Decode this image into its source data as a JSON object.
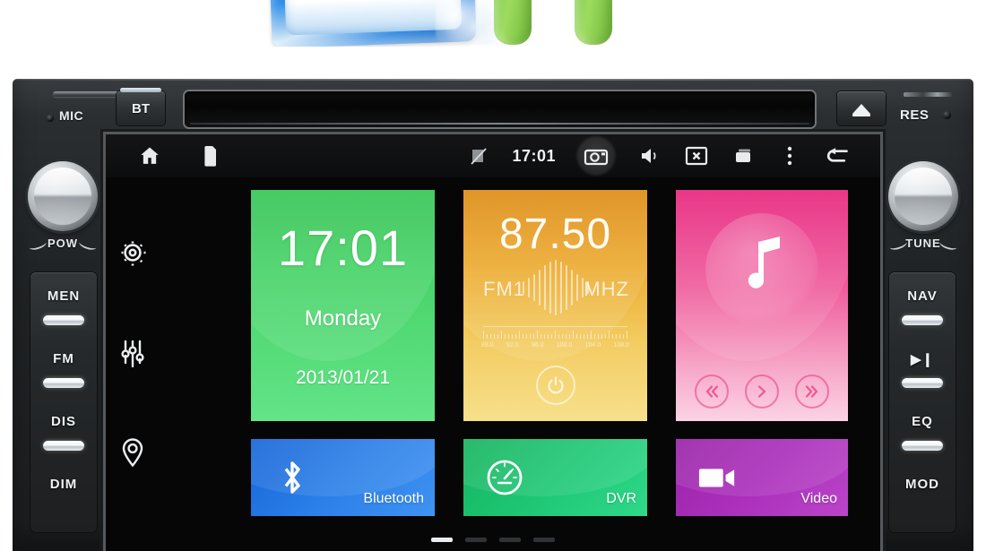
{
  "decor": {
    "package_name": "blue-product-package",
    "mascot_name": "android-robot-legs"
  },
  "head_unit": {
    "top_bezel": {
      "mic_label": "MIC",
      "bt_button": "BT",
      "cd_slot_name": "cd-slot",
      "eject_icon": "eject-icon",
      "res_label": "RES"
    },
    "knobs": [
      {
        "label": "POW",
        "name": "power-volume-knob"
      },
      {
        "label": "TUNE",
        "name": "tune-knob"
      }
    ],
    "left_buttons": [
      "MEN",
      "FM",
      "DIS",
      "DIM"
    ],
    "right_buttons": [
      "NAV",
      "▶❙",
      "EQ",
      "MOD"
    ]
  },
  "screen": {
    "statusbar": {
      "home_icon": "home-icon",
      "sdcard_icon": "sdcard-icon",
      "mute_icon": "mute-icon",
      "time": "17:01",
      "camera_icon": "camera-icon",
      "volume_icon": "volume-icon",
      "screenshot_icon": "close-box-icon",
      "recents_icon": "recent-apps-icon",
      "overflow_icon": "overflow-menu-icon",
      "back_icon": "back-icon"
    },
    "sidebar": [
      {
        "label": "Settings",
        "icon": "gear-icon"
      },
      {
        "label": "Equalizer",
        "icon": "sliders-icon"
      },
      {
        "label": "Navigation",
        "icon": "location-pin-icon"
      }
    ],
    "tiles": {
      "clock": {
        "time": "17:01",
        "day": "Monday",
        "date": "2013/01/21",
        "color": "#49d469"
      },
      "radio": {
        "frequency": "87.50",
        "band": "FM1",
        "unit": "MHZ",
        "power_icon": "power-icon",
        "scale_labels": [
          "88.0",
          "92.0",
          "96.0",
          "100.0",
          "104.0",
          "108.0"
        ],
        "color": "#ecaa2f"
      },
      "music": {
        "icon": "music-note-icon",
        "prev_icon": "previous-track-icon",
        "play_icon": "play-icon",
        "next_icon": "next-track-icon",
        "color": "#ef5c9c"
      },
      "bluetooth": {
        "label": "Bluetooth",
        "icon": "bluetooth-icon",
        "color": "#2b7fe8"
      },
      "dvr": {
        "label": "DVR",
        "icon": "speedometer-icon",
        "color": "#1ec774"
      },
      "video": {
        "label": "Video",
        "icon": "camcorder-icon",
        "color": "#ab2fbb"
      }
    },
    "pager": {
      "pages": 4,
      "active": 1
    }
  }
}
